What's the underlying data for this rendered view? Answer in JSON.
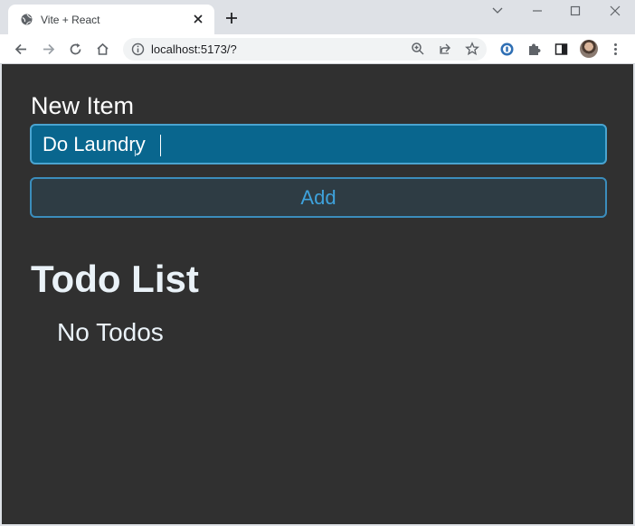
{
  "browser": {
    "tab_title": "Vite + React",
    "url": "localhost:5173/?"
  },
  "app": {
    "new_item_label": "New Item",
    "input_value": "Do Laundry",
    "add_button_label": "Add",
    "list_heading": "Todo List",
    "empty_message": "No Todos"
  },
  "icons": {
    "favicon": "globe-icon",
    "tab_close": "close-icon",
    "new_tab": "plus-icon",
    "back": "arrow-left-icon",
    "forward": "arrow-right-icon",
    "reload": "reload-icon",
    "home": "home-icon",
    "site_info": "info-icon",
    "zoom": "zoom-icon",
    "share": "share-icon",
    "bookmark": "star-icon",
    "password_manager": "key-icon",
    "extensions": "puzzle-icon",
    "side_panel": "sidebar-icon",
    "menu": "kebab-menu-icon"
  },
  "colors": {
    "app_background": "#303030",
    "input_background": "#09668e",
    "accent_blue": "#3ea2dc"
  }
}
